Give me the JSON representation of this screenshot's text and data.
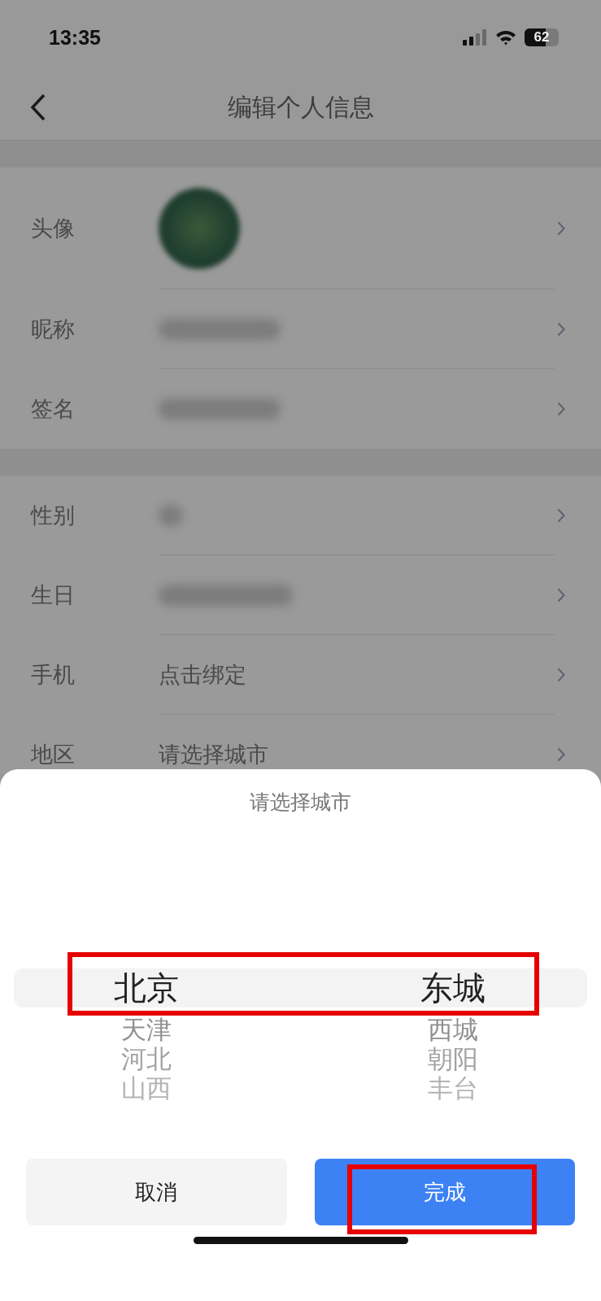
{
  "status_bar": {
    "time": "13:35",
    "battery": "62"
  },
  "nav": {
    "title": "编辑个人信息"
  },
  "sections": [
    [
      {
        "label": "头像",
        "kind": "avatar"
      },
      {
        "label": "昵称",
        "kind": "blurred"
      },
      {
        "label": "签名",
        "kind": "blurred"
      }
    ],
    [
      {
        "label": "性别",
        "kind": "blurred"
      },
      {
        "label": "生日",
        "kind": "blurred"
      },
      {
        "label": "手机",
        "kind": "text",
        "value": "点击绑定"
      },
      {
        "label": "地区",
        "kind": "text",
        "value": "请选择城市"
      }
    ]
  ],
  "sheet": {
    "title": "请选择城市",
    "picker_highlighted": true,
    "columns": [
      [
        {
          "label": "北京",
          "selected": true
        },
        {
          "label": "天津",
          "selected": false
        },
        {
          "label": "河北",
          "selected": false
        },
        {
          "label": "山西",
          "selected": false
        }
      ],
      [
        {
          "label": "东城",
          "selected": true
        },
        {
          "label": "西城",
          "selected": false
        },
        {
          "label": "朝阳",
          "selected": false
        },
        {
          "label": "丰台",
          "selected": false
        }
      ]
    ],
    "buttons": [
      {
        "label": "取消",
        "kind": "secondary",
        "highlighted": false
      },
      {
        "label": "完成",
        "kind": "primary",
        "highlighted": true
      }
    ]
  }
}
